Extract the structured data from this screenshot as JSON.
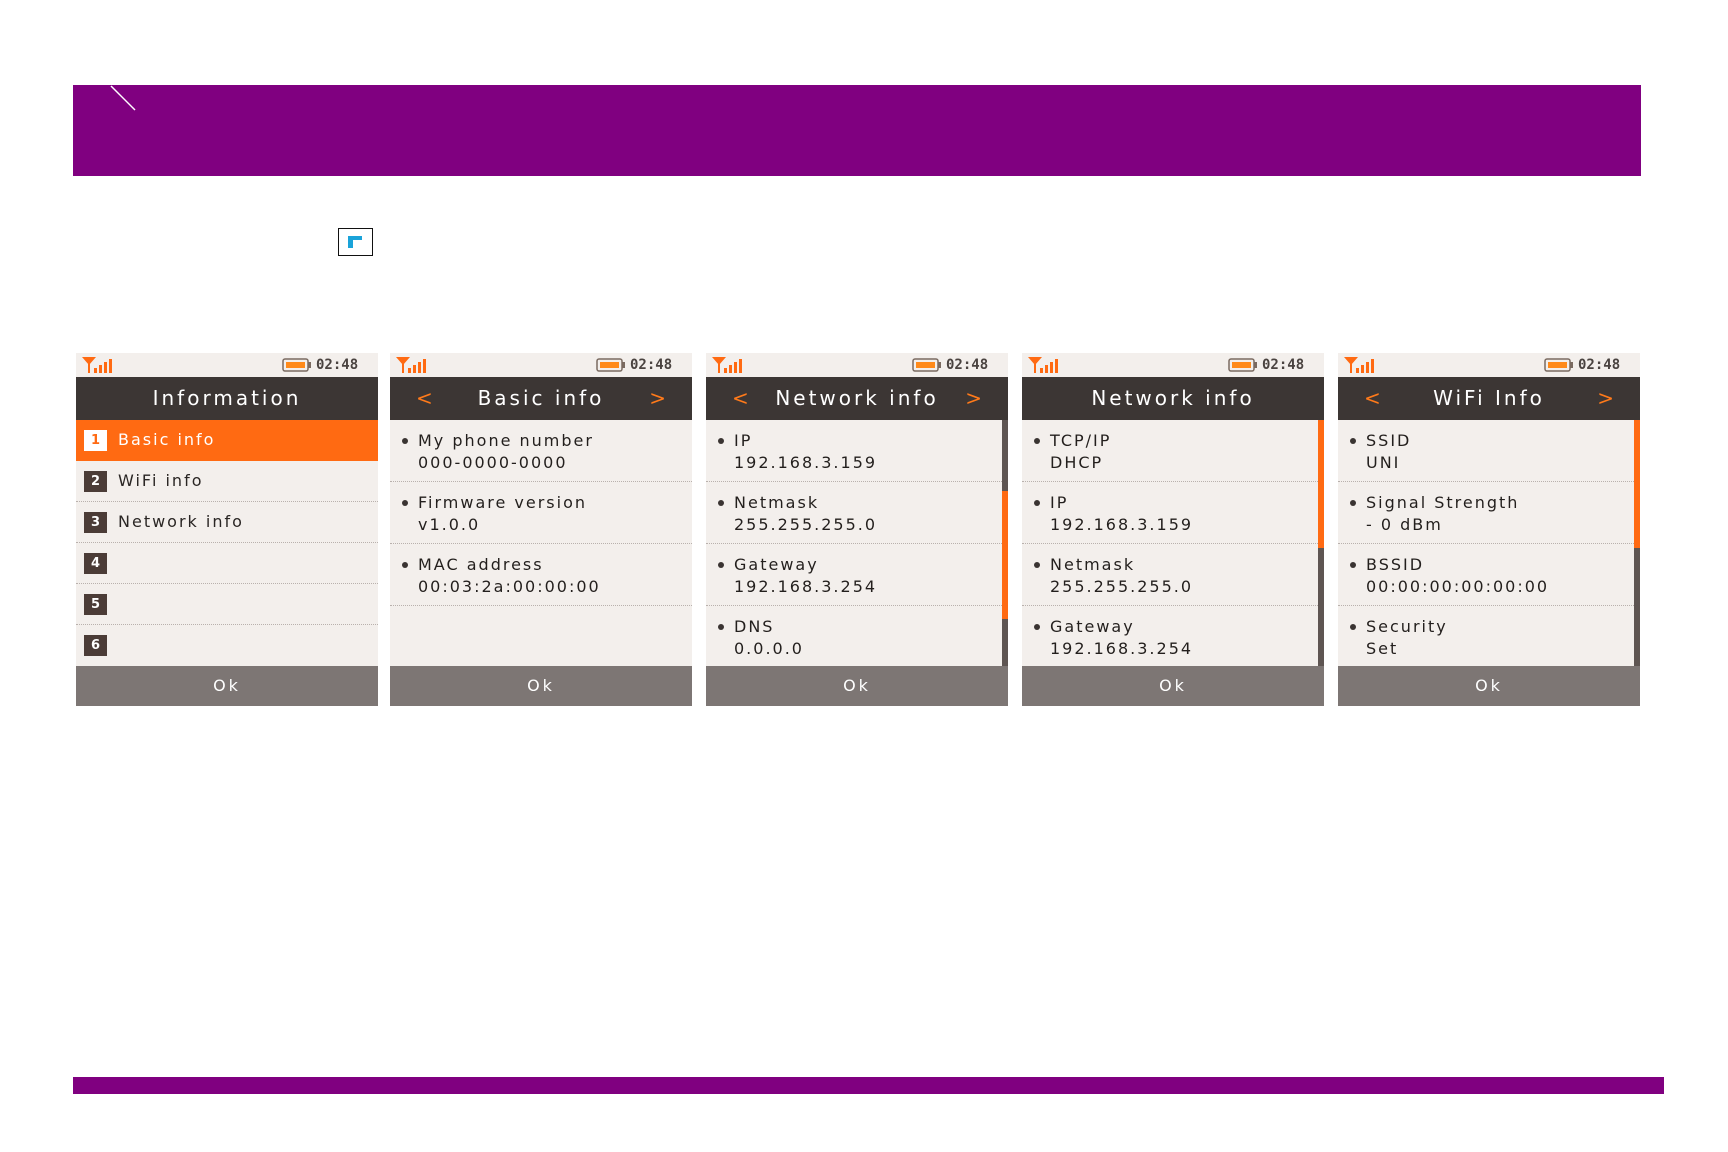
{
  "colors": {
    "brand": "#800080",
    "accent": "#ff6a12",
    "titlebar": "#3c3634",
    "screen_bg": "#f3efec",
    "okbar": "#7d7674"
  },
  "icons": {
    "banner_mark": "slash-mark-icon",
    "key": "blue-key-icon",
    "signal": "signal-bars-icon",
    "battery": "battery-icon"
  },
  "screens": [
    {
      "clock": "02:48",
      "title": "Information",
      "has_arrows": false,
      "menu": [
        {
          "num": "1",
          "label": "Basic info",
          "active": true
        },
        {
          "num": "2",
          "label": "WiFi info",
          "active": false
        },
        {
          "num": "3",
          "label": "Network info",
          "active": false
        },
        {
          "num": "4",
          "label": "",
          "active": false
        },
        {
          "num": "5",
          "label": "",
          "active": false
        },
        {
          "num": "6",
          "label": "",
          "active": false
        }
      ],
      "ok": "Ok"
    },
    {
      "clock": "02:48",
      "title": "Basic info",
      "has_arrows": true,
      "arrow_left": "<",
      "arrow_right": ">",
      "entries": [
        {
          "label": "My phone number",
          "value": "000-0000-0000"
        },
        {
          "label": "Firmware version",
          "value": "v1.0.0"
        },
        {
          "label": "MAC address",
          "value": "00:03:2a:00:00:00"
        }
      ],
      "ok": "Ok"
    },
    {
      "clock": "02:48",
      "title": "Network info",
      "has_arrows": true,
      "arrow_left": "<",
      "arrow_right": ">",
      "scroll_position": 0.6,
      "entries": [
        {
          "label": "IP",
          "value": "192.168.3.159"
        },
        {
          "label": "Netmask",
          "value": "255.255.255.0"
        },
        {
          "label": "Gateway",
          "value": "192.168.3.254"
        },
        {
          "label": "DNS",
          "value": "0.0.0.0"
        }
      ],
      "ok": "Ok"
    },
    {
      "clock": "02:48",
      "title": "Network info",
      "has_arrows": false,
      "scroll_position": 0.0,
      "entries": [
        {
          "label": "TCP/IP",
          "value": "DHCP"
        },
        {
          "label": "IP",
          "value": "192.168.3.159"
        },
        {
          "label": "Netmask",
          "value": "255.255.255.0"
        },
        {
          "label": "Gateway",
          "value": "192.168.3.254"
        }
      ],
      "ok": "Ok"
    },
    {
      "clock": "02:48",
      "title": "WiFi Info",
      "has_arrows": true,
      "arrow_left": "<",
      "arrow_right": ">",
      "scroll_position": 0.0,
      "entries": [
        {
          "label": "SSID",
          "value": "UNI"
        },
        {
          "label": "Signal Strength",
          "value": "- 0 dBm"
        },
        {
          "label": "BSSID",
          "value": "00:00:00:00:00:00"
        },
        {
          "label": "Security",
          "value": "Set"
        }
      ],
      "ok": "Ok"
    }
  ]
}
